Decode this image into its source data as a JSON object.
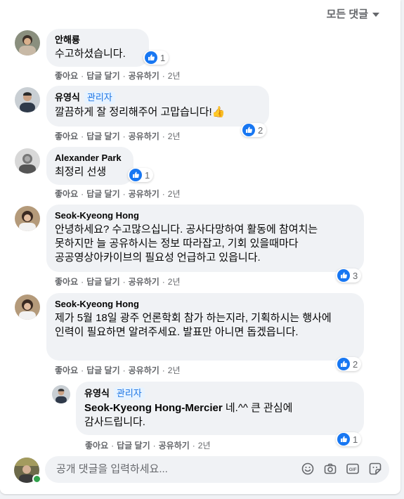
{
  "sort_label": "모든 댓글",
  "actions": {
    "like": "좋아요",
    "reply": "답글 달기",
    "share": "공유하기"
  },
  "comments": [
    {
      "author": "안해룡",
      "badge": "",
      "text": "수고하셨습니다.",
      "reactions": "1",
      "time": "2년"
    },
    {
      "author": "유영식",
      "badge": "관리자",
      "text": "깔끔하게 잘 정리해주어 고맙습니다!👍",
      "reactions": "2",
      "time": "2년"
    },
    {
      "author": "Alexander Park",
      "badge": "",
      "text": "최정리 선생",
      "reactions": "1",
      "time": "2년"
    },
    {
      "author": "Seok-Kyeong Hong",
      "badge": "",
      "text": "안녕하세요? 수고많으십니다. 공사다망하여 활동에 참여치는 못하지만 늘 공유하시는 정보 따라잡고, 기회 있을때마다 공공영상아카이브의 필요성 언급하고 있읍니다.",
      "reactions": "3",
      "time": "2년"
    },
    {
      "author": "Seok-Kyeong Hong",
      "badge": "",
      "text": "제가 5월 18일 광주 언론학회 참가 하는지라, 기획하시는 행사에 인력이 필요하면 알려주세요. 발표만 아니면 돕겠읍니다.",
      "reactions": "2",
      "time": "2년"
    }
  ],
  "reply": {
    "author": "유영식",
    "badge": "관리자",
    "mention": "Seok-Kyeong Hong-Mercier",
    "text": " 네.^^ 큰 관심에 감사드립니다.",
    "reactions": "1",
    "time": "2년"
  },
  "composer": {
    "placeholder": "공개 댓글을 입력하세요..."
  },
  "icons": [
    "thumbs-up-icon",
    "chevron-down-icon",
    "smiley-icon",
    "camera-icon",
    "gif-icon",
    "sticker-icon"
  ],
  "colors": {
    "like_blue": "#1877f2",
    "badge_blue": "#1b74e4",
    "bubble_gray": "#f0f2f5",
    "meta_gray": "#65676b",
    "online_green": "#31a24c"
  }
}
